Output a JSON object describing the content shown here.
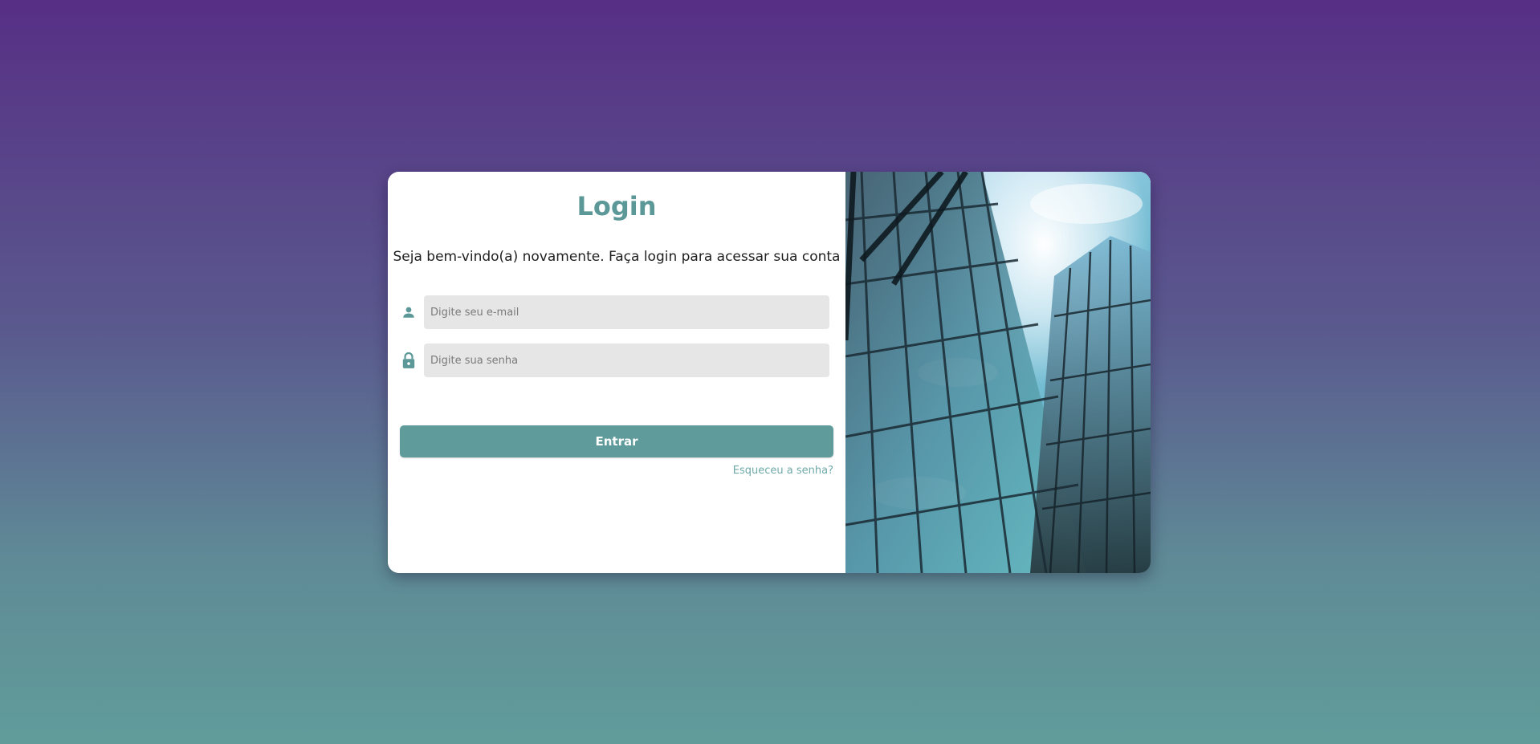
{
  "login": {
    "title": "Login",
    "subtitle": "Seja bem-vindo(a) novamente. Faça login para acessar sua conta",
    "email_placeholder": "Digite seu e-mail",
    "password_placeholder": "Digite sua senha",
    "submit_label": "Entrar",
    "forgot_label": "Esqueceu a senha?",
    "email_icon": "user-icon",
    "password_icon": "lock-icon"
  },
  "colors": {
    "accent": "#5f9b9a",
    "link": "#6fa9a8",
    "background_top": "#572f85",
    "background_bottom": "#619c9a",
    "input_bg": "#e6e6e6"
  },
  "hero_image": {
    "subject": "glass-skyscraper"
  }
}
